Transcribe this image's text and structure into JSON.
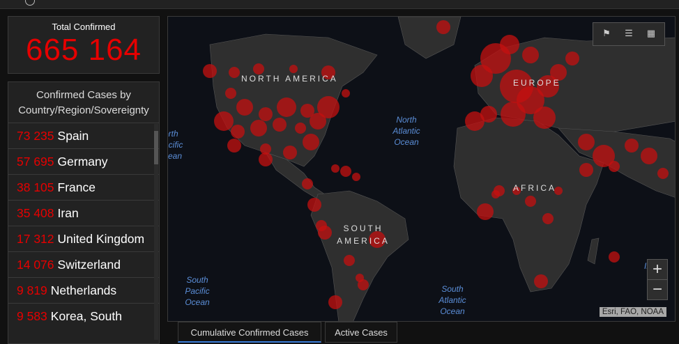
{
  "total": {
    "label": "Total Confirmed",
    "value": "665 164"
  },
  "list": {
    "header": "Confirmed Cases by Country/Region/Sovereignty",
    "items": [
      {
        "count": "73 235",
        "name": "Spain"
      },
      {
        "count": "57 695",
        "name": "Germany"
      },
      {
        "count": "38 105",
        "name": "France"
      },
      {
        "count": "35 408",
        "name": "Iran"
      },
      {
        "count": "17 312",
        "name": "United Kingdom"
      },
      {
        "count": "14 076",
        "name": "Switzerland"
      },
      {
        "count": "9 819",
        "name": "Netherlands"
      },
      {
        "count": "9 583",
        "name": "Korea, South"
      }
    ]
  },
  "map": {
    "labels": {
      "north_america": "NORTH AMERICA",
      "south_america": "SOUTH AMERICA",
      "europe": "EUROPE",
      "africa": "AFRICA",
      "north_atlantic": "North Atlantic Ocean",
      "south_atlantic": "South Atlantic Ocean",
      "south_pacific": "South Pacific Ocean",
      "north_pacific_partial": "orth acific cean",
      "indian_partial": "In"
    },
    "attribution": "Esri, FAO, NOAA",
    "zoom_in": "+",
    "zoom_out": "−",
    "bubble_color": "#c41010",
    "land_color": "#2f2f2f"
  },
  "tabs": [
    {
      "label": "Cumulative Confirmed Cases",
      "active": true
    },
    {
      "label": "Active Cases",
      "active": false
    }
  ]
}
